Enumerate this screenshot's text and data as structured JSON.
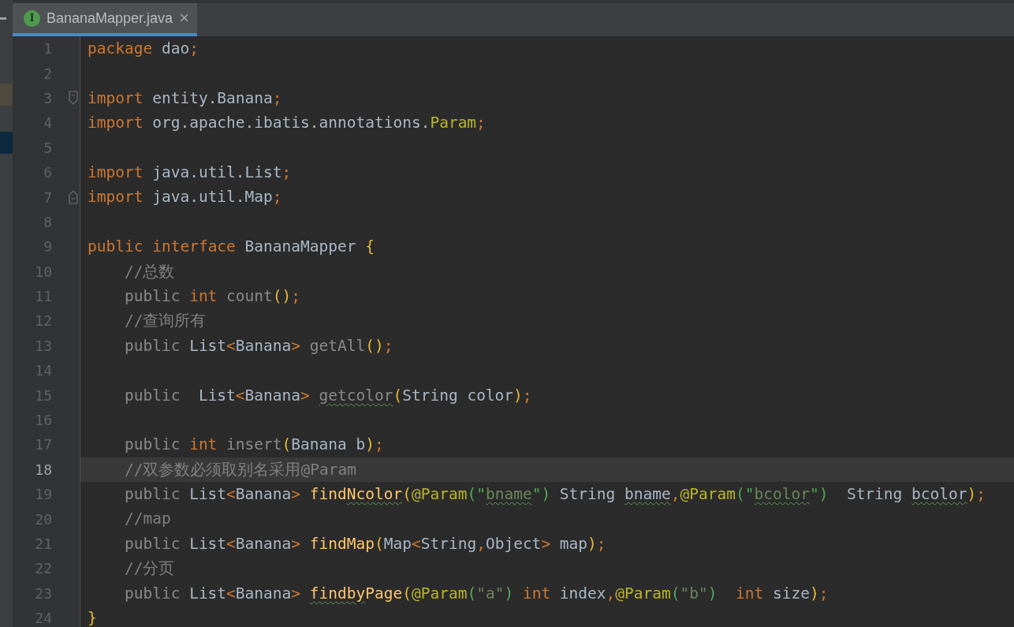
{
  "tab": {
    "label": "BananaMapper.java",
    "badge": "I",
    "selected": true,
    "close": "×"
  },
  "lines": [
    {
      "number": "1",
      "current": false,
      "kind": "plain",
      "tokens": [
        {
          "text": "package",
          "kind": "keyword",
          "typo": false
        },
        {
          "text": " dao",
          "kind": "text",
          "typo": false
        },
        {
          "text": ";",
          "kind": "punct",
          "typo": false
        }
      ]
    },
    {
      "number": "2",
      "current": false,
      "kind": "plain"
    },
    {
      "number": "3",
      "current": false,
      "kind": "fold_start",
      "tokens": [
        {
          "text": "import",
          "kind": "keyword",
          "typo": false
        },
        {
          "text": " entity.Banana",
          "kind": "text",
          "typo": false
        },
        {
          "text": ";",
          "kind": "punct",
          "typo": false
        }
      ]
    },
    {
      "number": "4",
      "current": false,
      "kind": "plain",
      "tokens": [
        {
          "text": "import",
          "kind": "keyword",
          "typo": false
        },
        {
          "text": " org.apache.ibatis.annotations.",
          "kind": "text",
          "typo": false
        },
        {
          "text": "Param",
          "kind": "annotation",
          "typo": false
        },
        {
          "text": ";",
          "kind": "punct",
          "typo": false
        }
      ]
    },
    {
      "number": "5",
      "current": false,
      "kind": "plain"
    },
    {
      "number": "6",
      "current": false,
      "kind": "plain",
      "tokens": [
        {
          "text": "import",
          "kind": "keyword",
          "typo": false
        },
        {
          "text": " java.util.List",
          "kind": "text",
          "typo": false
        },
        {
          "text": ";",
          "kind": "punct",
          "typo": false
        }
      ]
    },
    {
      "number": "7",
      "current": false,
      "kind": "fold_end",
      "tokens": [
        {
          "text": "import",
          "kind": "keyword",
          "typo": false
        },
        {
          "text": " java.util.Map",
          "kind": "text",
          "typo": false
        },
        {
          "text": ";",
          "kind": "punct",
          "typo": false
        }
      ]
    },
    {
      "number": "8",
      "current": false,
      "kind": "plain"
    },
    {
      "number": "9",
      "current": false,
      "kind": "plain",
      "tokens": [
        {
          "text": "public",
          "kind": "keyword",
          "typo": false
        },
        {
          "text": " interface",
          "kind": "keyword",
          "typo": false
        },
        {
          "text": " BananaMapper ",
          "kind": "text",
          "typo": false
        },
        {
          "text": "{",
          "kind": "brace",
          "typo": false
        }
      ]
    },
    {
      "number": "10",
      "current": false,
      "kind": "plain",
      "tokens": [
        {
          "text": "    //总数",
          "kind": "comment",
          "typo": false
        }
      ]
    },
    {
      "number": "11",
      "current": false,
      "kind": "plain",
      "tokens": [
        {
          "text": "    public ",
          "kind": "muted",
          "typo": false
        },
        {
          "text": "int",
          "kind": "keyword",
          "typo": false
        },
        {
          "text": " count",
          "kind": "muted",
          "typo": false
        },
        {
          "text": "()",
          "kind": "brace",
          "typo": false
        },
        {
          "text": ";",
          "kind": "punct",
          "typo": false
        }
      ]
    },
    {
      "number": "12",
      "current": false,
      "kind": "plain",
      "tokens": [
        {
          "text": "    //查询所有",
          "kind": "comment",
          "typo": false
        }
      ]
    },
    {
      "number": "13",
      "current": false,
      "kind": "plain",
      "tokens": [
        {
          "text": "    public ",
          "kind": "muted",
          "typo": false
        },
        {
          "text": "List",
          "kind": "text",
          "typo": false
        },
        {
          "text": "<",
          "kind": "punct",
          "typo": false
        },
        {
          "text": "Banana",
          "kind": "text",
          "typo": false
        },
        {
          "text": ">",
          "kind": "punct",
          "typo": false
        },
        {
          "text": " getAll",
          "kind": "muted",
          "typo": false
        },
        {
          "text": "()",
          "kind": "brace",
          "typo": false
        },
        {
          "text": ";",
          "kind": "punct",
          "typo": false
        }
      ]
    },
    {
      "number": "14",
      "current": false,
      "kind": "plain"
    },
    {
      "number": "15",
      "current": false,
      "kind": "plain",
      "tokens": [
        {
          "text": "    public  ",
          "kind": "muted",
          "typo": false
        },
        {
          "text": "List",
          "kind": "text",
          "typo": false
        },
        {
          "text": "<",
          "kind": "punct",
          "typo": false
        },
        {
          "text": "Banana",
          "kind": "text",
          "typo": false
        },
        {
          "text": "> ",
          "kind": "punct",
          "typo": false
        },
        {
          "text": "getcolor",
          "kind": "muted",
          "typo": true
        },
        {
          "text": "(",
          "kind": "brace",
          "typo": false
        },
        {
          "text": "String color",
          "kind": "text",
          "typo": false
        },
        {
          "text": ")",
          "kind": "brace",
          "typo": false
        },
        {
          "text": ";",
          "kind": "punct",
          "typo": false
        }
      ]
    },
    {
      "number": "16",
      "current": false,
      "kind": "plain"
    },
    {
      "number": "17",
      "current": false,
      "kind": "plain",
      "tokens": [
        {
          "text": "    public ",
          "kind": "muted",
          "typo": false
        },
        {
          "text": "int",
          "kind": "keyword",
          "typo": false
        },
        {
          "text": " insert",
          "kind": "muted",
          "typo": false
        },
        {
          "text": "(",
          "kind": "brace",
          "typo": false
        },
        {
          "text": "Banana b",
          "kind": "text",
          "typo": false
        },
        {
          "text": ")",
          "kind": "brace",
          "typo": false
        },
        {
          "text": ";",
          "kind": "punct",
          "typo": false
        }
      ]
    },
    {
      "number": "18",
      "current": true,
      "kind": "plain",
      "tokens": [
        {
          "text": "    //双参数必须取别名采用@Param",
          "kind": "comment",
          "typo": false
        }
      ]
    },
    {
      "number": "19",
      "current": false,
      "kind": "plain",
      "tokens": [
        {
          "text": "    public ",
          "kind": "muted",
          "typo": false
        },
        {
          "text": "List",
          "kind": "text",
          "typo": false
        },
        {
          "text": "<",
          "kind": "punct",
          "typo": false
        },
        {
          "text": "Banana",
          "kind": "text",
          "typo": false
        },
        {
          "text": "> ",
          "kind": "punct",
          "typo": false
        },
        {
          "text": "find",
          "kind": "method",
          "typo": false
        },
        {
          "text": "Ncolor",
          "kind": "method",
          "typo": true
        },
        {
          "text": "(",
          "kind": "brace",
          "typo": false
        },
        {
          "text": "@Param",
          "kind": "annotation",
          "typo": false
        },
        {
          "text": "(",
          "kind": "quote",
          "typo": false
        },
        {
          "text": "\"",
          "kind": "quote",
          "typo": false
        },
        {
          "text": "bname",
          "kind": "string",
          "typo": true
        },
        {
          "text": "\"",
          "kind": "quote",
          "typo": false
        },
        {
          "text": ")",
          "kind": "quote",
          "typo": false
        },
        {
          "text": " String ",
          "kind": "text",
          "typo": false
        },
        {
          "text": "bname",
          "kind": "text",
          "typo": true
        },
        {
          "text": ",",
          "kind": "punct",
          "typo": false
        },
        {
          "text": "@Param",
          "kind": "annotation",
          "typo": false
        },
        {
          "text": "(",
          "kind": "quote",
          "typo": false
        },
        {
          "text": "\"",
          "kind": "quote",
          "typo": false
        },
        {
          "text": "bcolor",
          "kind": "string",
          "typo": true
        },
        {
          "text": "\"",
          "kind": "quote",
          "typo": false
        },
        {
          "text": ")",
          "kind": "quote",
          "typo": false
        },
        {
          "text": "  String ",
          "kind": "text",
          "typo": false
        },
        {
          "text": "bcolor",
          "kind": "text",
          "typo": true
        },
        {
          "text": ")",
          "kind": "brace",
          "typo": false
        },
        {
          "text": ";",
          "kind": "punct",
          "typo": false
        }
      ]
    },
    {
      "number": "20",
      "current": false,
      "kind": "plain",
      "tokens": [
        {
          "text": "    //map",
          "kind": "comment",
          "typo": false
        }
      ]
    },
    {
      "number": "21",
      "current": false,
      "kind": "plain",
      "tokens": [
        {
          "text": "    public ",
          "kind": "muted",
          "typo": false
        },
        {
          "text": "List",
          "kind": "text",
          "typo": false
        },
        {
          "text": "<",
          "kind": "punct",
          "typo": false
        },
        {
          "text": "Banana",
          "kind": "text",
          "typo": false
        },
        {
          "text": "> ",
          "kind": "punct",
          "typo": false
        },
        {
          "text": "findMap",
          "kind": "method",
          "typo": false
        },
        {
          "text": "(",
          "kind": "brace",
          "typo": false
        },
        {
          "text": "Map",
          "kind": "text",
          "typo": false
        },
        {
          "text": "<",
          "kind": "punct",
          "typo": false
        },
        {
          "text": "String",
          "kind": "text",
          "typo": false
        },
        {
          "text": ",",
          "kind": "punct",
          "typo": false
        },
        {
          "text": "Object",
          "kind": "text",
          "typo": false
        },
        {
          "text": ">",
          "kind": "punct",
          "typo": false
        },
        {
          "text": " map",
          "kind": "text",
          "typo": false
        },
        {
          "text": ")",
          "kind": "brace",
          "typo": false
        },
        {
          "text": ";",
          "kind": "punct",
          "typo": false
        }
      ]
    },
    {
      "number": "22",
      "current": false,
      "kind": "plain",
      "tokens": [
        {
          "text": "    //分页",
          "kind": "comment",
          "typo": false
        }
      ]
    },
    {
      "number": "23",
      "current": false,
      "kind": "plain",
      "tokens": [
        {
          "text": "    public ",
          "kind": "muted",
          "typo": false
        },
        {
          "text": "List",
          "kind": "text",
          "typo": false
        },
        {
          "text": "<",
          "kind": "punct",
          "typo": false
        },
        {
          "text": "Banana",
          "kind": "text",
          "typo": false
        },
        {
          "text": "> ",
          "kind": "punct",
          "typo": false
        },
        {
          "text": "findby",
          "kind": "method",
          "typo": true
        },
        {
          "text": "Page",
          "kind": "method",
          "typo": false
        },
        {
          "text": "(",
          "kind": "brace",
          "typo": false
        },
        {
          "text": "@Param",
          "kind": "annotation",
          "typo": false
        },
        {
          "text": "(",
          "kind": "quote",
          "typo": false
        },
        {
          "text": "\"a\"",
          "kind": "string",
          "typo": false
        },
        {
          "text": ")",
          "kind": "quote",
          "typo": false
        },
        {
          "text": " int",
          "kind": "keyword",
          "typo": false
        },
        {
          "text": " index",
          "kind": "text",
          "typo": false
        },
        {
          "text": ",",
          "kind": "punct",
          "typo": false
        },
        {
          "text": "@Param",
          "kind": "annotation",
          "typo": false
        },
        {
          "text": "(",
          "kind": "quote",
          "typo": false
        },
        {
          "text": "\"b\"",
          "kind": "string",
          "typo": false
        },
        {
          "text": ")",
          "kind": "quote",
          "typo": false
        },
        {
          "text": "  int",
          "kind": "keyword",
          "typo": false
        },
        {
          "text": " size",
          "kind": "text",
          "typo": false
        },
        {
          "text": ")",
          "kind": "brace",
          "typo": false
        },
        {
          "text": ";",
          "kind": "punct",
          "typo": false
        }
      ]
    },
    {
      "number": "24",
      "current": false,
      "kind": "plain",
      "tokens": [
        {
          "text": "}",
          "kind": "brace",
          "typo": false
        }
      ]
    }
  ]
}
